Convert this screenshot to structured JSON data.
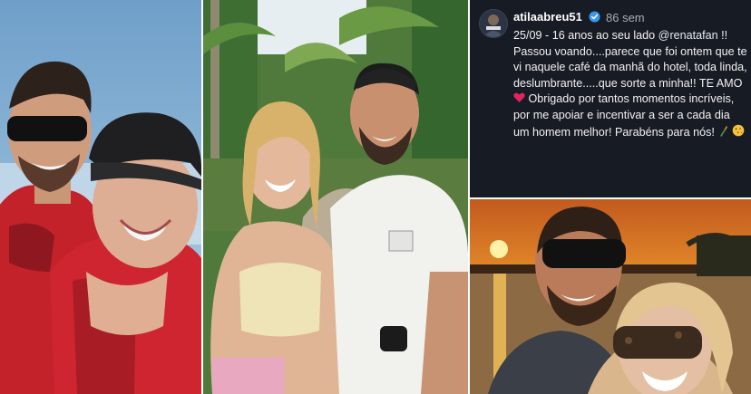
{
  "comment": {
    "username": "atilaabreu51",
    "time_ago": "86 sem",
    "verified": true,
    "line1": "25/09 - 16 anos ao seu lado",
    "mention": "@renatafan",
    "body": "!! Passou voando....parece que foi ontem que te vi naquele café da manhã do hotel, toda linda, deslumbrante.....que sorte a minha!! TE AMO",
    "body2": "Obrigado por tantos momentos incríveis, por me apoiar e incentivar a ser a cada dia um homem melhor! Parabéns para nós!"
  },
  "photos": [
    {
      "name": "jet-ski-selfie"
    },
    {
      "name": "palm-path-selfie"
    },
    {
      "name": "sunset-selfie"
    }
  ],
  "colors": {
    "comment_bg": "#171b24",
    "verified": "#3897f0",
    "heart": "#e0245e",
    "life_vest": "#d1222c"
  },
  "icons": [
    "verified-badge-icon",
    "heart-icon",
    "bottle-icon",
    "kiss-face-icon"
  ]
}
